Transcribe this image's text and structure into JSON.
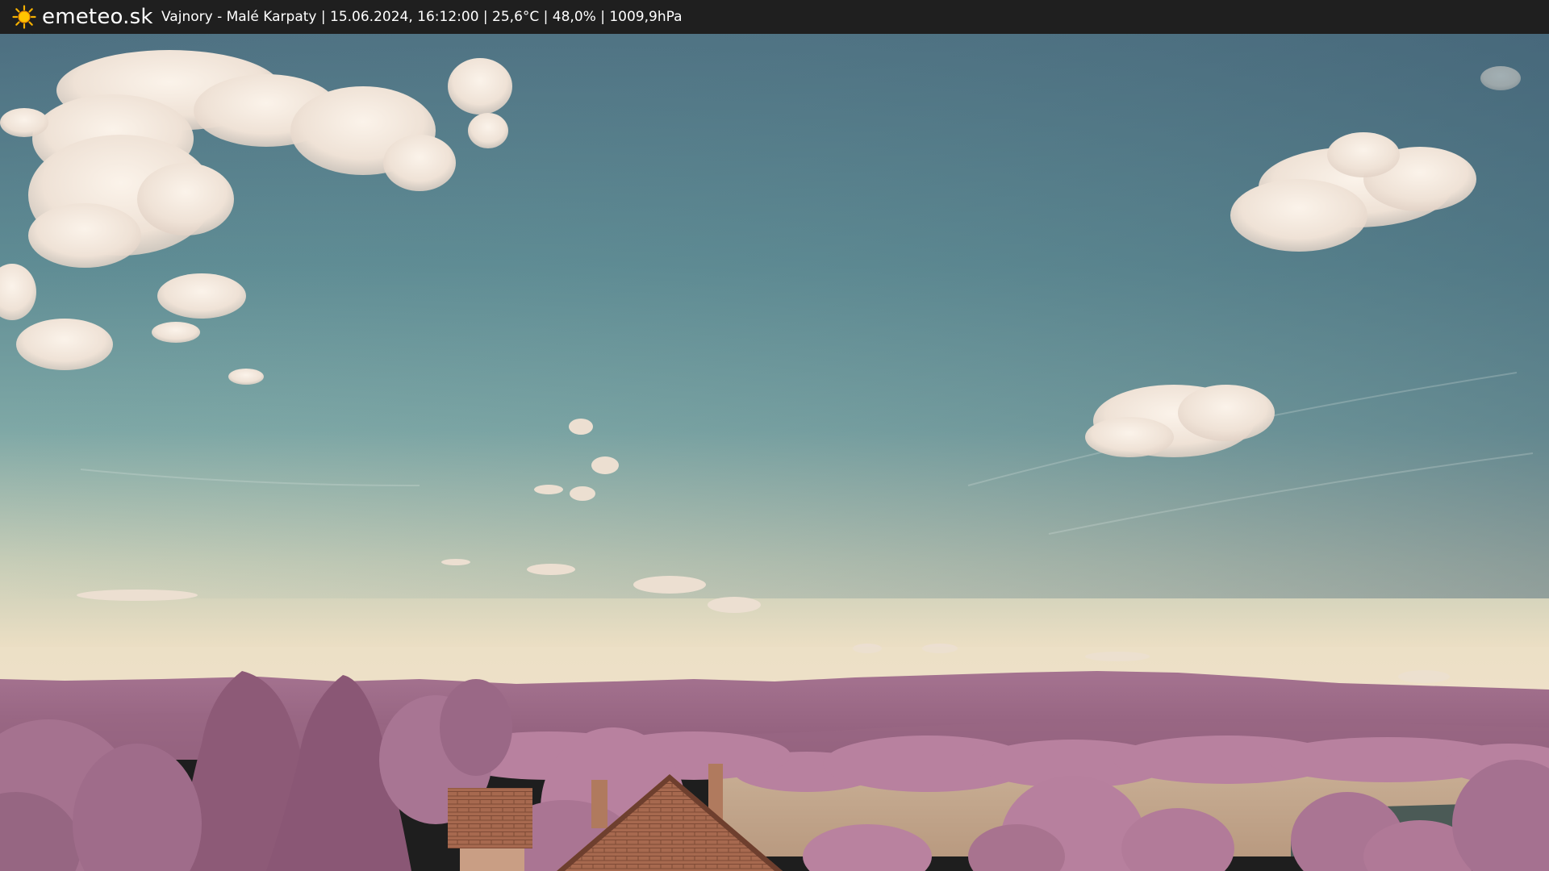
{
  "header": {
    "brand": "emeteo.sk",
    "caption": "Vajnory - Malé Karpaty | 15.06.2024, 16:12:00 | 25,6°C | 48,0% | 1009,9hPa"
  },
  "scene": {
    "subject": "infrared-style webcam view over fields, trees, rooftops and hills"
  },
  "colors": {
    "topbar": "#1f1f1f",
    "sky_top": "#4e7283",
    "sky_mid": "#6e9ba0",
    "horizon": "#e8dcc2",
    "foliage": "#b27c9c",
    "hills": "#9c6a86",
    "field": "#c9ad92",
    "roof": "#a86d52"
  }
}
